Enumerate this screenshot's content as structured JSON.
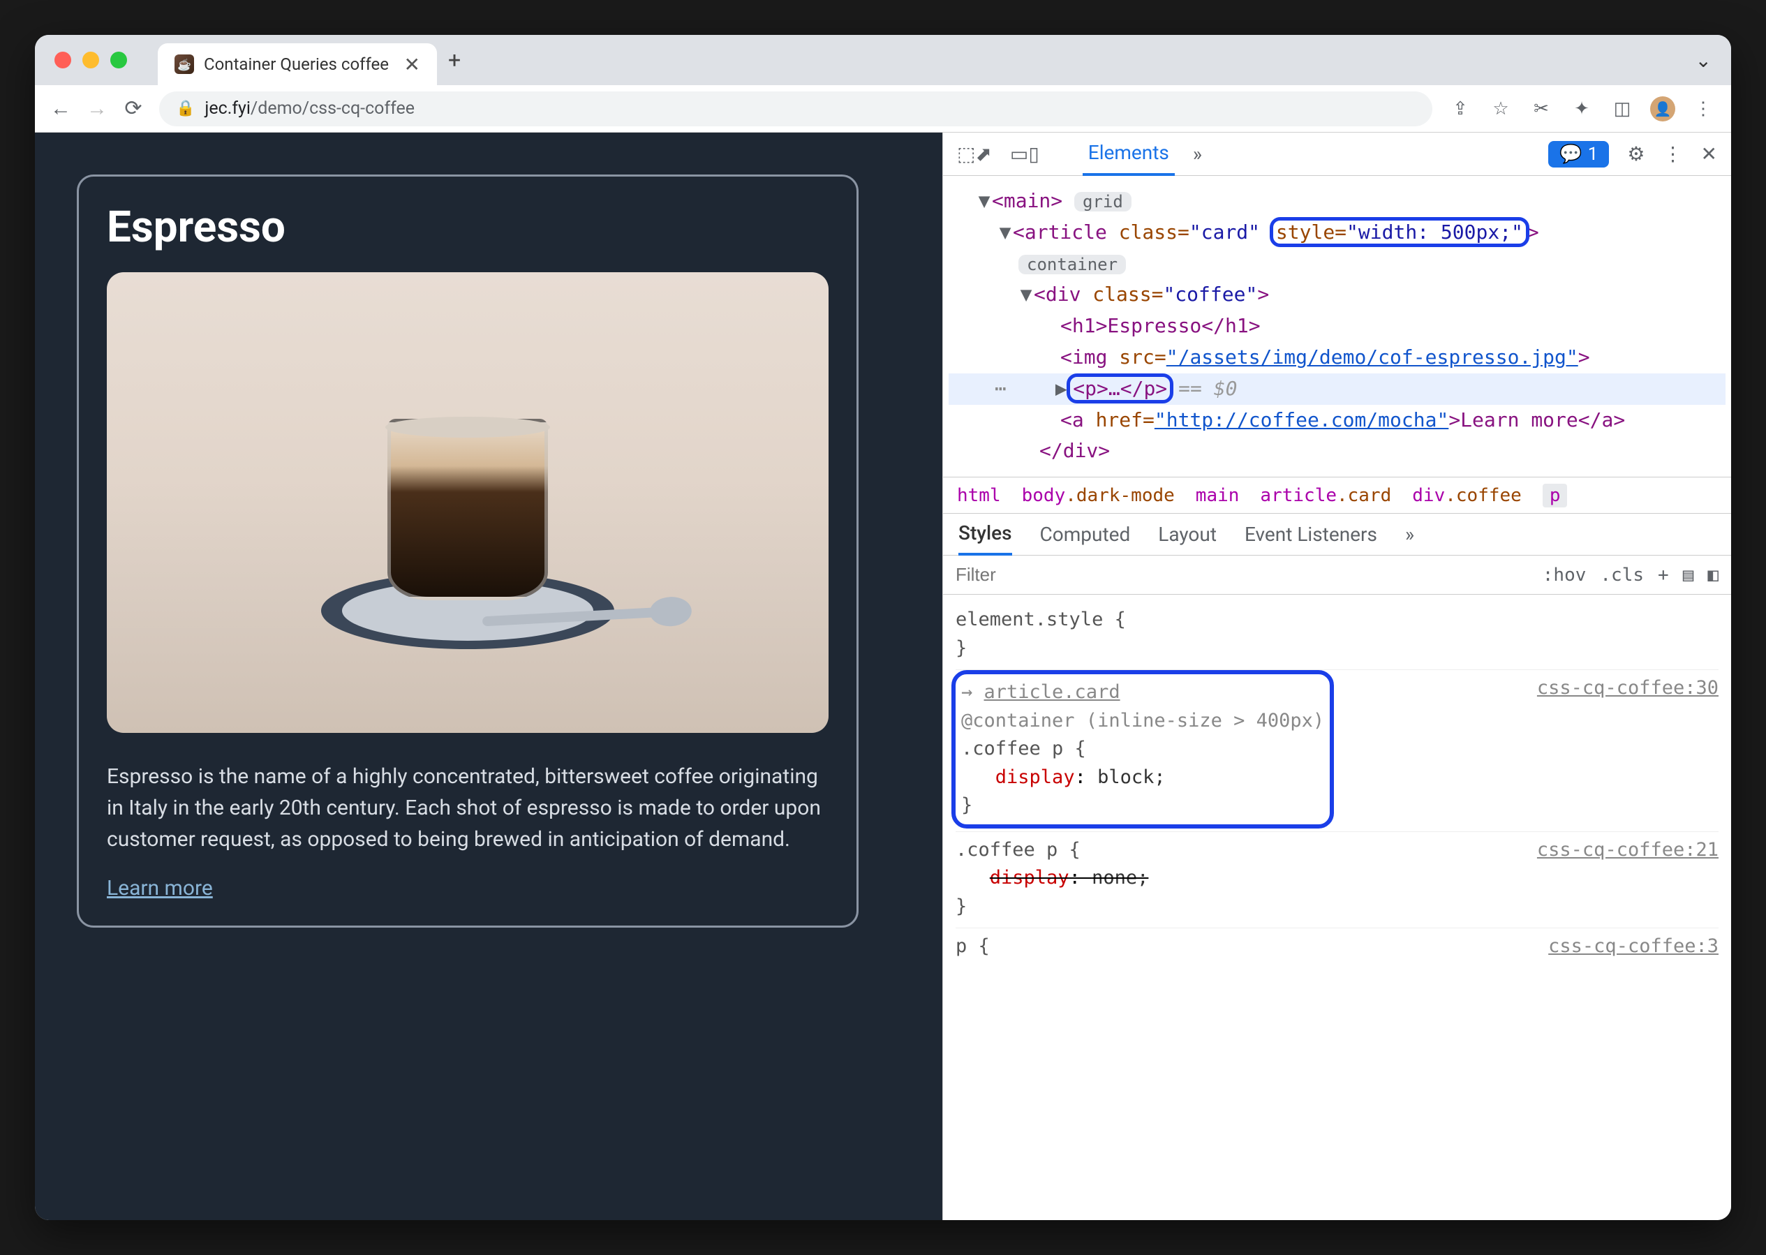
{
  "tab": {
    "title": "Container Queries coffee"
  },
  "address": {
    "domain": "jec.fyi",
    "path": "/demo/css-cq-coffee"
  },
  "page": {
    "heading": "Espresso",
    "body": "Espresso is the name of a highly concentrated, bittersweet coffee originating in Italy in the early 20th century. Each shot of espresso is made to order upon customer request, as opposed to being brewed in anticipation of demand.",
    "link": "Learn more"
  },
  "devtools": {
    "tabs": {
      "elements": "Elements"
    },
    "badge_count": "1",
    "dom": {
      "main_open": "<main>",
      "main_badge": "grid",
      "article_open_a": "<article ",
      "article_open_b": "class=",
      "article_class": "\"card\"",
      "article_style_attr": "style=",
      "article_style_val": "\"width: 500px;\"",
      "article_close": ">",
      "article_badge": "container",
      "div_open_a": "<div ",
      "div_open_b": "class=",
      "div_class": "\"coffee\"",
      "div_close": ">",
      "h1": "<h1>Espresso</h1>",
      "img_a": "<img ",
      "img_b": "src=",
      "img_src": "\"/assets/img/demo/cof-espresso.jpg\"",
      "img_close": ">",
      "p": "<p>…</p>",
      "eq0": "== $0",
      "a_a": "<a ",
      "a_b": "href=",
      "a_href": "\"http://coffee.com/mocha\"",
      "a_text": ">Learn more</a>",
      "div_end": "</div>"
    },
    "crumbs": [
      "html",
      "body.dark-mode",
      "main",
      "article.card",
      "div.coffee",
      "p"
    ],
    "style_tabs": {
      "styles": "Styles",
      "computed": "Computed",
      "layout": "Layout",
      "listeners": "Event Listeners"
    },
    "filter_placeholder": "Filter",
    "filter_btns": {
      "hov": ":hov",
      "cls": ".cls"
    },
    "rules": {
      "r0_sel": "element.style {",
      "r0_end": "}",
      "r1_inherit": "article.card",
      "r1_cq": "@container (inline-size > 400px)",
      "r1_sel": ".coffee p {",
      "r1_prop": "display",
      "r1_val": "block;",
      "r1_end": "}",
      "r1_src": "css-cq-coffee:30",
      "r2_sel": ".coffee p {",
      "r2_prop": "display",
      "r2_val": "none;",
      "r2_end": "}",
      "r2_src": "css-cq-coffee:21",
      "r3_sel": "p {",
      "r3_src": "css-cq-coffee:3"
    }
  }
}
